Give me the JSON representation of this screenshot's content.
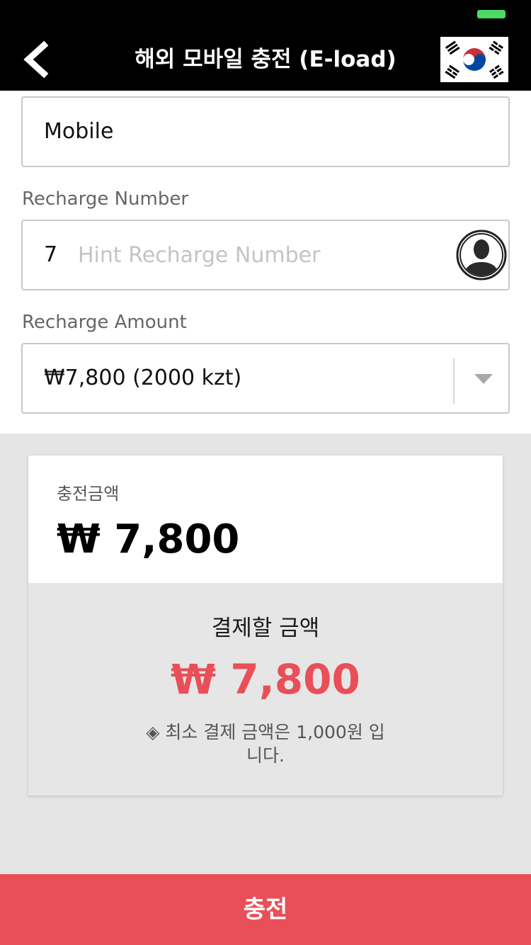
{
  "header": {
    "title": "해외 모바일 충전 (E-load)",
    "back_icon": "chevron-left-icon",
    "flag_icon": "south-korea-flag-icon"
  },
  "form": {
    "type_field": {
      "value": "Mobile"
    },
    "recharge_number": {
      "label": "Recharge Number",
      "prefix": "7",
      "value": "",
      "placeholder": "Hint Recharge Number",
      "contact_icon": "contact-person-icon"
    },
    "recharge_amount": {
      "label": "Recharge Amount",
      "selected": "₩7,800 (2000 kzt)",
      "dropdown_icon": "caret-down-icon"
    }
  },
  "summary": {
    "charge_label": "충전금액",
    "charge_value": "₩ 7,800",
    "pay_label": "결제할 금액",
    "pay_value": "₩ 7,800",
    "note": "◈ 최소 결제 금액은 1,000원 입니다."
  },
  "footer": {
    "charge_button": "충전"
  },
  "colors": {
    "header_bg": "#000000",
    "accent": "#e84f58",
    "battery": "#4cd964",
    "gray_bg": "#e5e5e5"
  }
}
